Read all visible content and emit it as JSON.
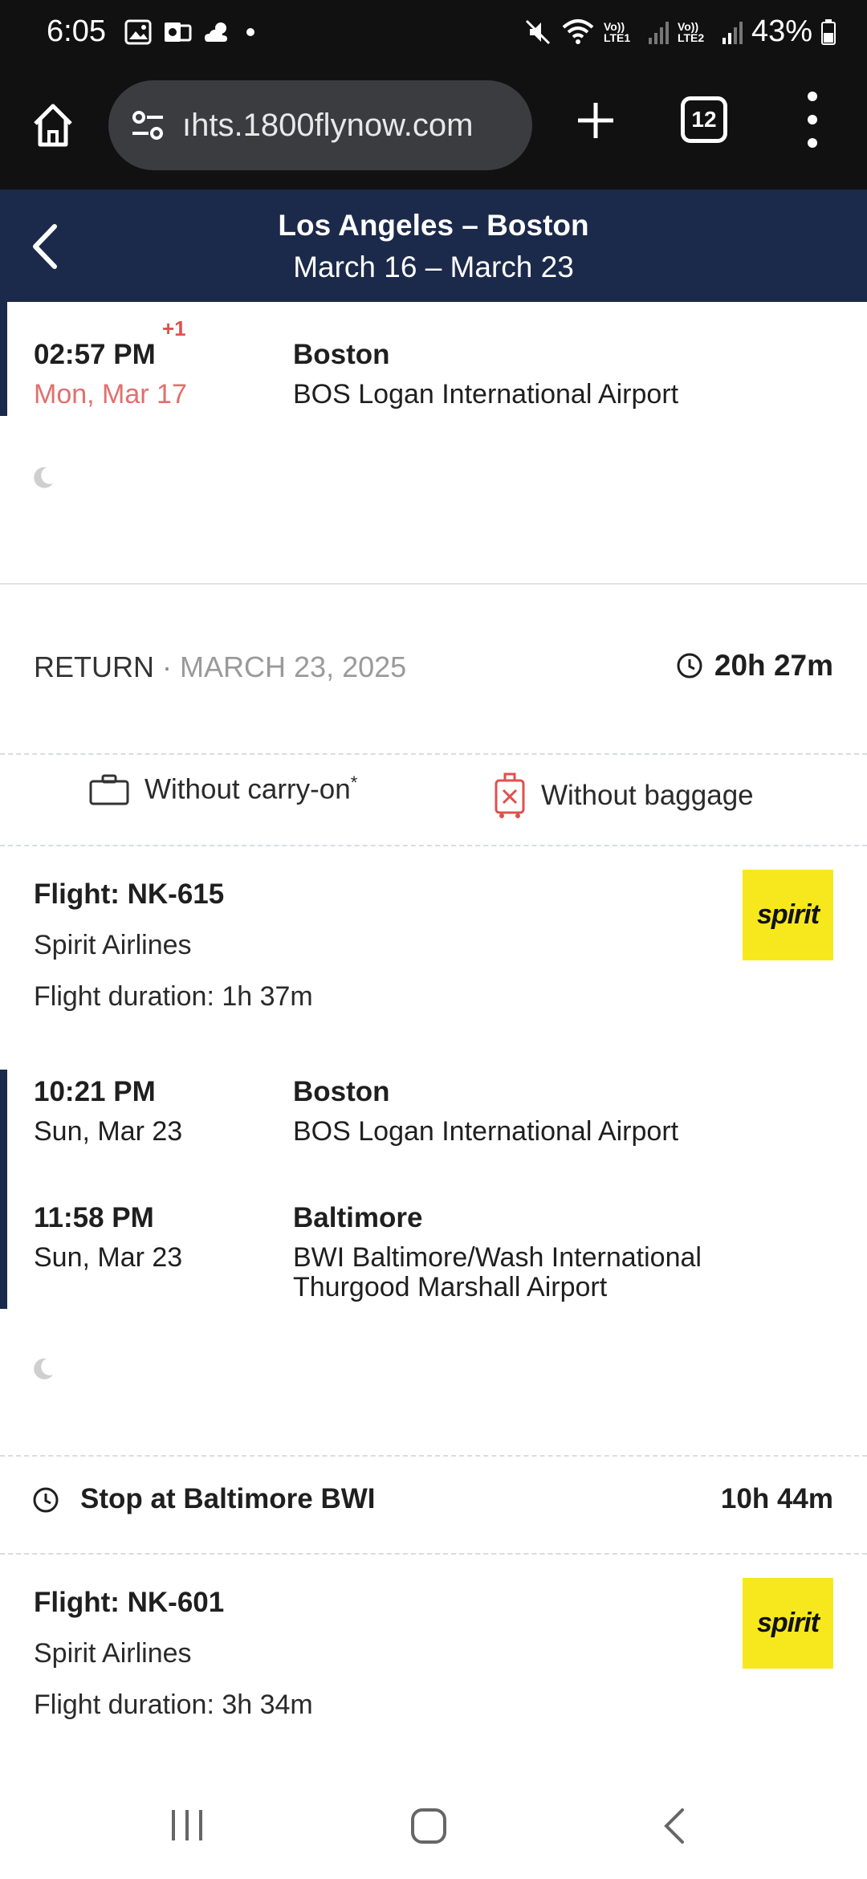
{
  "status_bar": {
    "time": "6:05",
    "battery": "43%",
    "lte1": "Vo)) LTE1",
    "lte2": "Vo)) LTE2"
  },
  "browser": {
    "url": "ıhts.1800flynow.com",
    "tab_count": "12"
  },
  "header": {
    "title": "Los Angeles – Boston",
    "dates": "March 16 – March 23"
  },
  "outbound_arrival": {
    "time": "02:57 PM",
    "day_offset": "+1",
    "date": "Mon, Mar 17",
    "city": "Boston",
    "airport": "BOS Logan International Airport"
  },
  "return": {
    "label": "RETURN",
    "separator": "·",
    "date": "MARCH 23, 2025",
    "total_duration": "20h  27m"
  },
  "baggage": {
    "carry_on": "Without carry-on",
    "carry_on_mark": "*",
    "checked": "Without baggage"
  },
  "flight1": {
    "title": "Flight: NK-615",
    "airline": "Spirit Airlines",
    "duration": "Flight duration: 1h  37m",
    "logo_text": "spirit",
    "departure": {
      "time": "10:21 PM",
      "date": "Sun, Mar 23",
      "city": "Boston",
      "airport": "BOS Logan International Airport"
    },
    "arrival": {
      "time": "11:58 PM",
      "date": "Sun, Mar 23",
      "city": "Baltimore",
      "airport_line1": "BWI Baltimore/Wash International",
      "airport_line2": "Thurgood Marshall Airport"
    }
  },
  "stop": {
    "label": "Stop at Baltimore BWI",
    "duration": "10h  44m"
  },
  "flight2": {
    "title": "Flight: NK-601",
    "airline": "Spirit Airlines",
    "duration": "Flight duration: 3h  34m",
    "logo_text": "spirit"
  },
  "colors": {
    "header_bg": "#1b2a4a",
    "logo_bg": "#f7e81e",
    "accent_red": "#e0504c"
  }
}
